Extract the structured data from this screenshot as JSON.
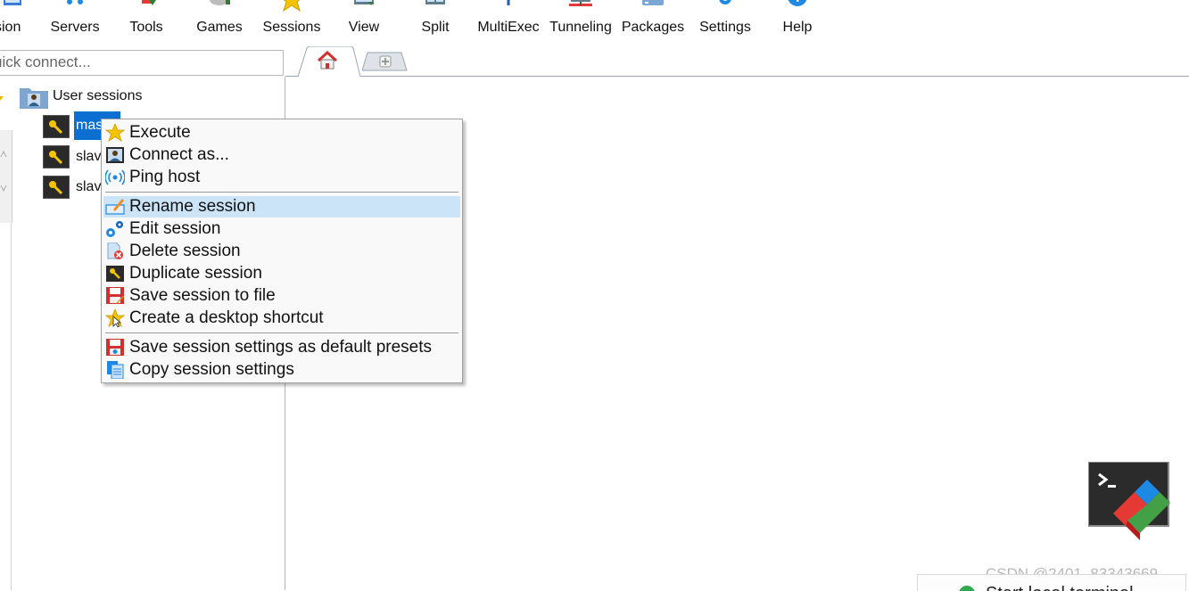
{
  "toolbar": {
    "items": [
      {
        "label": "sion",
        "icon": "session-icon"
      },
      {
        "label": "Servers",
        "icon": "servers-icon"
      },
      {
        "label": "Tools",
        "icon": "tools-icon"
      },
      {
        "label": "Games",
        "icon": "games-icon"
      },
      {
        "label": "Sessions",
        "icon": "star-icon"
      },
      {
        "label": "View",
        "icon": "view-icon"
      },
      {
        "label": "Split",
        "icon": "split-icon"
      },
      {
        "label": "MultiExec",
        "icon": "multiexec-icon"
      },
      {
        "label": "Tunneling",
        "icon": "tunneling-icon"
      },
      {
        "label": "Packages",
        "icon": "packages-icon"
      },
      {
        "label": "Settings",
        "icon": "gear-icon"
      },
      {
        "label": "Help",
        "icon": "help-icon"
      }
    ]
  },
  "quick_connect": {
    "value": "uick connect..."
  },
  "tabs": {
    "home_icon": "home-icon",
    "new_tab_icon": "plus-icon"
  },
  "tree": {
    "root_label": "User sessions",
    "sessions": [
      {
        "label": "mas",
        "selected": true
      },
      {
        "label": "slav",
        "selected": false
      },
      {
        "label": "slav",
        "selected": false
      }
    ]
  },
  "context_menu": {
    "items": [
      {
        "label": "Execute",
        "icon": "star-icon"
      },
      {
        "label": "Connect as...",
        "icon": "user-icon"
      },
      {
        "label": "Ping host",
        "icon": "ping-icon"
      },
      {
        "label": "Rename session",
        "icon": "rename-icon",
        "highlighted": true
      },
      {
        "label": "Edit session",
        "icon": "edit-gears-icon"
      },
      {
        "label": "Delete session",
        "icon": "delete-icon"
      },
      {
        "label": "Duplicate session",
        "icon": "key-icon"
      },
      {
        "label": "Save session to file",
        "icon": "save-icon"
      },
      {
        "label": "Create a desktop shortcut",
        "icon": "shortcut-star-icon"
      },
      {
        "label": "Save session settings as default presets",
        "icon": "save-settings-icon"
      },
      {
        "label": "Copy session settings",
        "icon": "copy-icon"
      }
    ]
  },
  "watermark": "CSDN @2401_83343669",
  "start_tip": "Start local terminal",
  "colors": {
    "selection": "#0a6fd1",
    "menu_highlight": "#cce4f7",
    "accent_blue": "#1e88e5"
  }
}
